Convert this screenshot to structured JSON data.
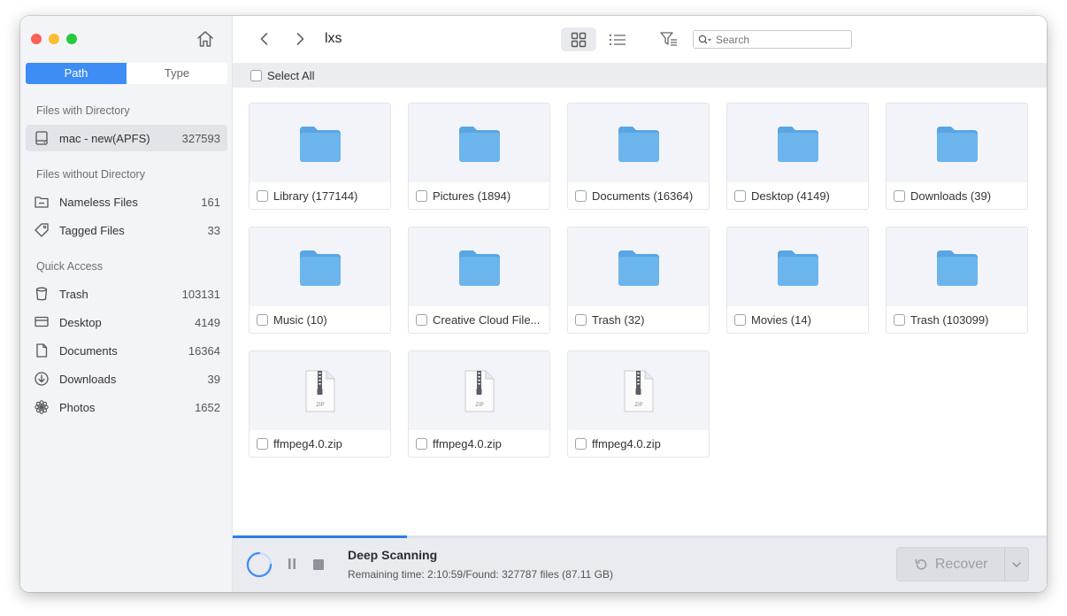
{
  "sidebar": {
    "tabs": [
      {
        "label": "Path",
        "active": true
      },
      {
        "label": "Type",
        "active": false
      }
    ],
    "sections": {
      "with_directory": "Files with Directory",
      "without_directory": "Files without Directory",
      "quick_access": "Quick Access"
    },
    "drive": {
      "label": "mac - new(APFS)",
      "count": "327593"
    },
    "no_dir_items": [
      {
        "label": "Nameless Files",
        "count": "161",
        "icon": "folder-minus-icon"
      },
      {
        "label": "Tagged Files",
        "count": "33",
        "icon": "tag-icon"
      }
    ],
    "quick_items": [
      {
        "label": "Trash",
        "count": "103131",
        "icon": "trash-icon"
      },
      {
        "label": "Desktop",
        "count": "4149",
        "icon": "desktop-icon"
      },
      {
        "label": "Documents",
        "count": "16364",
        "icon": "document-icon"
      },
      {
        "label": "Downloads",
        "count": "39",
        "icon": "download-icon"
      },
      {
        "label": "Photos",
        "count": "1652",
        "icon": "photos-icon"
      }
    ]
  },
  "toolbar": {
    "path_title": "lxs",
    "search_placeholder": "Search"
  },
  "select_all_label": "Select All",
  "items": [
    {
      "name": "Library (177144)",
      "type": "folder"
    },
    {
      "name": "Pictures (1894)",
      "type": "folder"
    },
    {
      "name": "Documents (16364)",
      "type": "folder"
    },
    {
      "name": "Desktop (4149)",
      "type": "folder"
    },
    {
      "name": "Downloads (39)",
      "type": "folder"
    },
    {
      "name": "Music (10)",
      "type": "folder"
    },
    {
      "name": "Creative Cloud File...",
      "type": "folder"
    },
    {
      "name": "Trash (32)",
      "type": "folder"
    },
    {
      "name": "Movies (14)",
      "type": "folder"
    },
    {
      "name": "Trash (103099)",
      "type": "folder"
    },
    {
      "name": "ffmpeg4.0.zip",
      "type": "zip"
    },
    {
      "name": "ffmpeg4.0.zip",
      "type": "zip"
    },
    {
      "name": "ffmpeg4.0.zip",
      "type": "zip"
    }
  ],
  "zip_label": "ZIP",
  "scan": {
    "title": "Deep Scanning",
    "status": "Remaining time: 2:10:59/Found: 327787 files (87.11 GB)",
    "progress_fraction": 0.214
  },
  "recover_label": "Recover",
  "colors": {
    "accent": "#3d8df5",
    "folder": "#6cb4ec",
    "folder_tab": "#58a6e4"
  }
}
